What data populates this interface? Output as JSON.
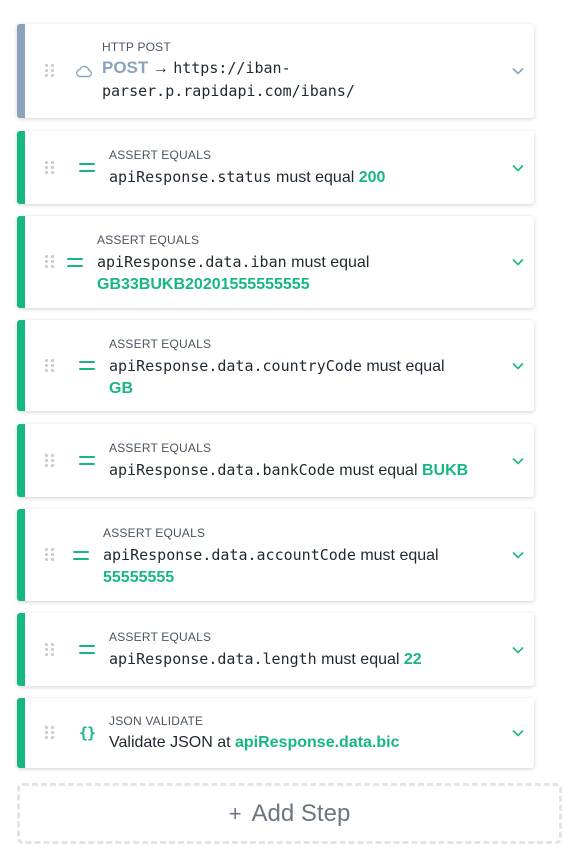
{
  "steps": [
    {
      "type_label": "HTTP POST",
      "method": "POST",
      "arrow": "→",
      "url": "https://iban-parser.p.rapidapi.com/ibans/",
      "icon": "cloud-icon",
      "accent": "#8aa3bb"
    },
    {
      "type_label": "ASSERT EQUALS",
      "property": "apiResponse.status",
      "verb": "must equal",
      "value": "200",
      "icon": "equals-icon",
      "accent": "#17b87f"
    },
    {
      "type_label": "ASSERT EQUALS",
      "property": "apiResponse.data.iban",
      "verb": "must equal",
      "value": "GB33BUKB20201555555555",
      "icon": "equals-icon",
      "accent": "#17b87f"
    },
    {
      "type_label": "ASSERT EQUALS",
      "property": "apiResponse.data.countryCode",
      "verb": "must equal",
      "value": "GB",
      "icon": "equals-icon",
      "accent": "#17b87f"
    },
    {
      "type_label": "ASSERT EQUALS",
      "property": "apiResponse.data.bankCode",
      "verb": "must equal",
      "value": "BUKB",
      "icon": "equals-icon",
      "accent": "#17b87f"
    },
    {
      "type_label": "ASSERT EQUALS",
      "property": "apiResponse.data.accountCode",
      "verb": "must equal",
      "value": "55555555",
      "icon": "equals-icon",
      "accent": "#17b87f"
    },
    {
      "type_label": "ASSERT EQUALS",
      "property": "apiResponse.data.length",
      "verb": "must equal",
      "value": "22",
      "icon": "equals-icon",
      "accent": "#17b87f"
    },
    {
      "type_label": "JSON VALIDATE",
      "text": "Validate JSON at",
      "value": "apiResponse.data.bic",
      "icon": "braces-icon",
      "accent": "#17b87f"
    }
  ],
  "add_step": {
    "plus": "+",
    "label": "Add Step"
  }
}
